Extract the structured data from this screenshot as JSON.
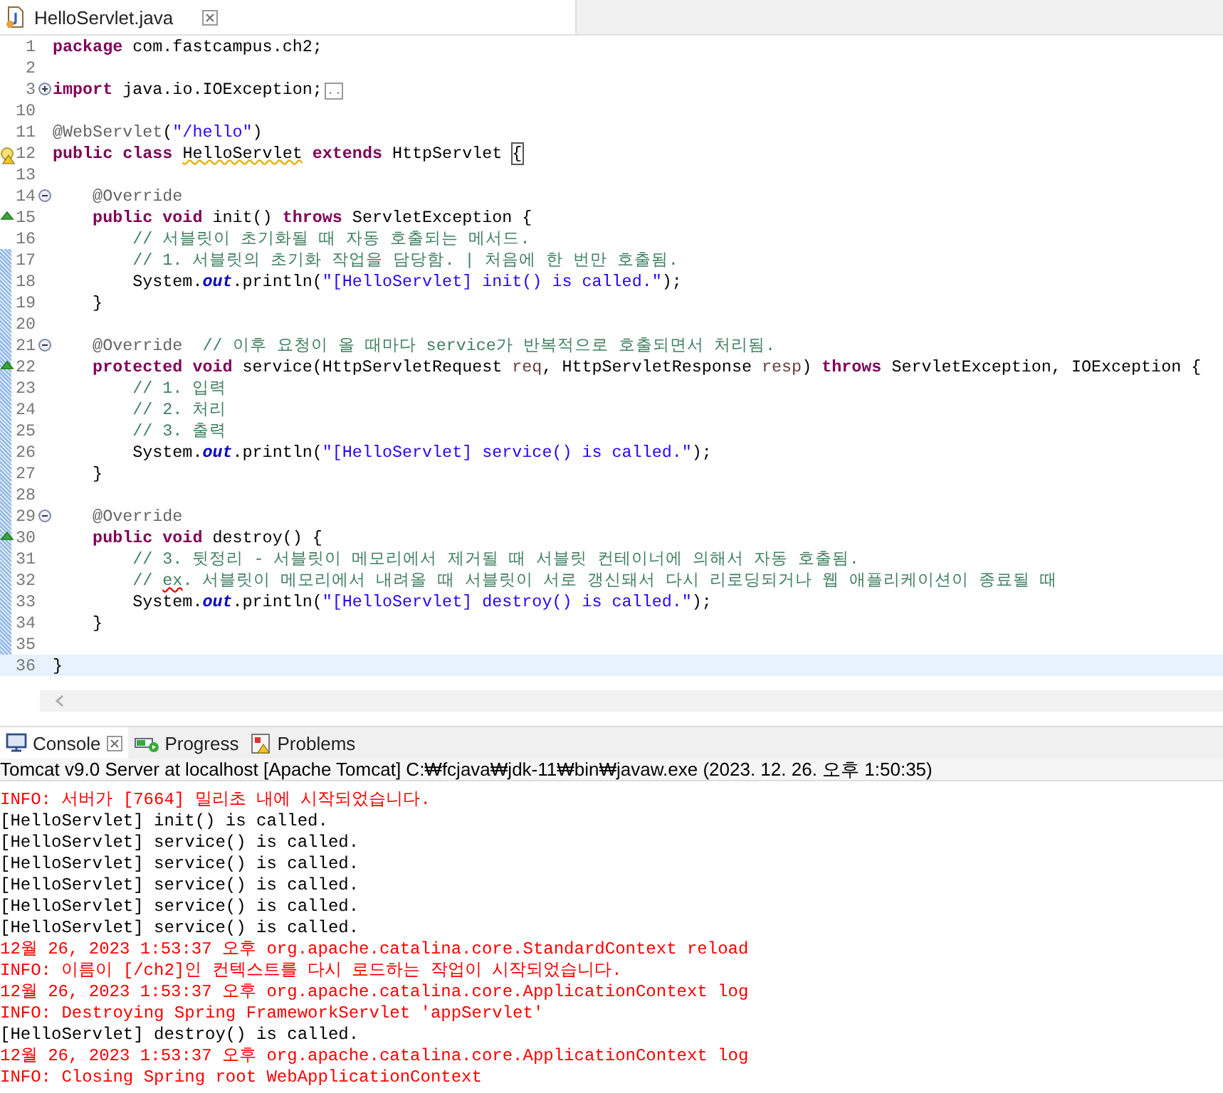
{
  "editor": {
    "tab": {
      "title": "HelloServlet.java",
      "selected": true
    },
    "lines": [
      {
        "number": "1",
        "current": false,
        "tokens": [
          {
            "kind": "keyword",
            "text": "package"
          },
          {
            "kind": "plain",
            "text": " com.fastcampus.ch2;"
          }
        ]
      },
      {
        "number": "2",
        "current": false
      },
      {
        "number": "3",
        "fold": {
          "expanded": false
        },
        "current": false,
        "tokens": [
          {
            "kind": "keyword",
            "text": "import"
          },
          {
            "kind": "plain",
            "text": " java.io.IOException;"
          },
          {
            "kind": "folded",
            "text": ".."
          }
        ]
      },
      {
        "number": "10",
        "current": false
      },
      {
        "number": "11",
        "current": false,
        "tokens": [
          {
            "kind": "annotation",
            "text": "@WebServlet"
          },
          {
            "kind": "plain",
            "text": "("
          },
          {
            "kind": "string",
            "text": "\"/hello\""
          },
          {
            "kind": "plain",
            "text": ")"
          }
        ]
      },
      {
        "number": "12",
        "warning": true,
        "current": false,
        "tokens": [
          {
            "kind": "keyword",
            "text": "public class "
          },
          {
            "kind": "warned",
            "text": "HelloServlet"
          },
          {
            "kind": "keyword",
            "text": " extends"
          },
          {
            "kind": "plain",
            "text": " HttpServlet "
          },
          {
            "kind": "bracket",
            "text": "{"
          }
        ]
      },
      {
        "number": "13",
        "current": false
      },
      {
        "number": "14",
        "fold": {
          "expanded": true
        },
        "current": false,
        "tokens": [
          {
            "kind": "annotation",
            "text": "    @Override"
          }
        ]
      },
      {
        "number": "15",
        "overrides": true,
        "current": false,
        "tokens": [
          {
            "kind": "keyword",
            "text": "    public void"
          },
          {
            "kind": "plain",
            "text": " init() "
          },
          {
            "kind": "keyword",
            "text": "throws"
          },
          {
            "kind": "plain",
            "text": " ServletException {"
          }
        ]
      },
      {
        "number": "16",
        "current": false,
        "tokens": [
          {
            "kind": "comment",
            "text": "        // 서블릿이 초기화될 때 자동 호출되는 메서드."
          }
        ]
      },
      {
        "number": "17",
        "current": false,
        "tokens": [
          {
            "kind": "comment",
            "text": "        // 1. 서블릿의 초기화 작업을 담당함. | 처음에 한 번만 호출됨."
          }
        ]
      },
      {
        "number": "18",
        "current": false,
        "tokens": [
          {
            "kind": "plain",
            "text": "        System."
          },
          {
            "kind": "field",
            "text": "out"
          },
          {
            "kind": "plain",
            "text": ".println("
          },
          {
            "kind": "string",
            "text": "\"[HelloServlet] init() is called.\""
          },
          {
            "kind": "plain",
            "text": ");"
          }
        ]
      },
      {
        "number": "19",
        "current": false,
        "tokens": [
          {
            "kind": "plain",
            "text": "    }"
          }
        ]
      },
      {
        "number": "20",
        "current": false
      },
      {
        "number": "21",
        "fold": {
          "expanded": true
        },
        "current": false,
        "tokens": [
          {
            "kind": "annotation",
            "text": "    @Override"
          },
          {
            "kind": "comment",
            "text": "  // 이후 요청이 올 때마다 service가 반복적으로 호출되면서 처리됨."
          }
        ]
      },
      {
        "number": "22",
        "overrides": true,
        "current": false,
        "tokens": [
          {
            "kind": "keyword",
            "text": "    protected void"
          },
          {
            "kind": "plain",
            "text": " service(HttpServletRequest "
          },
          {
            "kind": "param",
            "text": "req"
          },
          {
            "kind": "plain",
            "text": ", HttpServletResponse "
          },
          {
            "kind": "param",
            "text": "resp"
          },
          {
            "kind": "plain",
            "text": ") "
          },
          {
            "kind": "keyword",
            "text": "throws"
          },
          {
            "kind": "plain",
            "text": " ServletException, IOException {"
          }
        ]
      },
      {
        "number": "23",
        "current": false,
        "tokens": [
          {
            "kind": "comment",
            "text": "        // 1. 입력"
          }
        ]
      },
      {
        "number": "24",
        "current": false,
        "tokens": [
          {
            "kind": "comment",
            "text": "        // 2. 처리"
          }
        ]
      },
      {
        "number": "25",
        "current": false,
        "tokens": [
          {
            "kind": "comment",
            "text": "        // 3. 출력"
          }
        ]
      },
      {
        "number": "26",
        "current": false,
        "tokens": [
          {
            "kind": "plain",
            "text": "        System."
          },
          {
            "kind": "field",
            "text": "out"
          },
          {
            "kind": "plain",
            "text": ".println("
          },
          {
            "kind": "string",
            "text": "\"[HelloServlet] service() is called.\""
          },
          {
            "kind": "plain",
            "text": ");"
          }
        ]
      },
      {
        "number": "27",
        "current": false,
        "tokens": [
          {
            "kind": "plain",
            "text": "    }"
          }
        ]
      },
      {
        "number": "28",
        "current": false
      },
      {
        "number": "29",
        "fold": {
          "expanded": true
        },
        "current": false,
        "tokens": [
          {
            "kind": "annotation",
            "text": "    @Override"
          }
        ]
      },
      {
        "number": "30",
        "overrides": true,
        "current": false,
        "tokens": [
          {
            "kind": "keyword",
            "text": "    public void"
          },
          {
            "kind": "plain",
            "text": " destroy() {"
          }
        ]
      },
      {
        "number": "31",
        "current": false,
        "tokens": [
          {
            "kind": "comment",
            "text": "        // 3. 뒷정리 - 서블릿이 메모리에서 제거될 때 서블릿 컨테이너에 의해서 자동 호출됨."
          }
        ]
      },
      {
        "number": "32",
        "current": false,
        "tokens": [
          {
            "kind": "comment",
            "text": "        // "
          },
          {
            "kind": "spelling",
            "text": "ex"
          },
          {
            "kind": "comment",
            "text": ". 서블릿이 메모리에서 내려올 때 서블릿이 서로 갱신돼서 다시 리로딩되거나 웹 애플리케이션이 종료될 때"
          }
        ]
      },
      {
        "number": "33",
        "current": false,
        "tokens": [
          {
            "kind": "plain",
            "text": "        System."
          },
          {
            "kind": "field",
            "text": "out"
          },
          {
            "kind": "plain",
            "text": ".println("
          },
          {
            "kind": "string",
            "text": "\"[HelloServlet] destroy() is called.\""
          },
          {
            "kind": "plain",
            "text": ");"
          }
        ]
      },
      {
        "number": "34",
        "current": false,
        "tokens": [
          {
            "kind": "plain",
            "text": "    }"
          }
        ]
      },
      {
        "number": "35",
        "current": false
      },
      {
        "number": "36",
        "current": true,
        "tokens": [
          {
            "kind": "plain",
            "text": "}"
          }
        ]
      }
    ]
  },
  "console": {
    "tabs": [
      {
        "label": "Console",
        "selected": true
      },
      {
        "label": "Progress",
        "selected": false
      },
      {
        "label": "Problems",
        "selected": false
      }
    ],
    "process": "Tomcat v9.0 Server at localhost [Apache Tomcat] C:₩fcjava₩jdk-11₩bin₩javaw.exe  (2023. 12. 26. 오후 1:50:35)",
    "output": [
      {
        "kind": "stderr",
        "text": "INFO: 서버가 [7664] 밀리초 내에 시작되었습니다."
      },
      {
        "kind": "stdout",
        "text": "[HelloServlet] init() is called."
      },
      {
        "kind": "stdout",
        "text": "[HelloServlet] service() is called."
      },
      {
        "kind": "stdout",
        "text": "[HelloServlet] service() is called."
      },
      {
        "kind": "stdout",
        "text": "[HelloServlet] service() is called."
      },
      {
        "kind": "stdout",
        "text": "[HelloServlet] service() is called."
      },
      {
        "kind": "stdout",
        "text": "[HelloServlet] service() is called."
      },
      {
        "kind": "stderr",
        "text": "12월 26, 2023 1:53:37 오후 org.apache.catalina.core.StandardContext reload"
      },
      {
        "kind": "stderr",
        "text": "INFO: 이름이 [/ch2]인 컨텍스트를 다시 로드하는 작업이 시작되었습니다."
      },
      {
        "kind": "stderr",
        "text": "12월 26, 2023 1:53:37 오후 org.apache.catalina.core.ApplicationContext log"
      },
      {
        "kind": "stderr",
        "text": "INFO: Destroying Spring FrameworkServlet 'appServlet'"
      },
      {
        "kind": "stdout",
        "text": "[HelloServlet] destroy() is called."
      },
      {
        "kind": "stderr",
        "text": "12월 26, 2023 1:53:37 오후 org.apache.catalina.core.ApplicationContext log"
      },
      {
        "kind": "stderr",
        "text": "INFO: Closing Spring root WebApplicationContext"
      }
    ]
  }
}
